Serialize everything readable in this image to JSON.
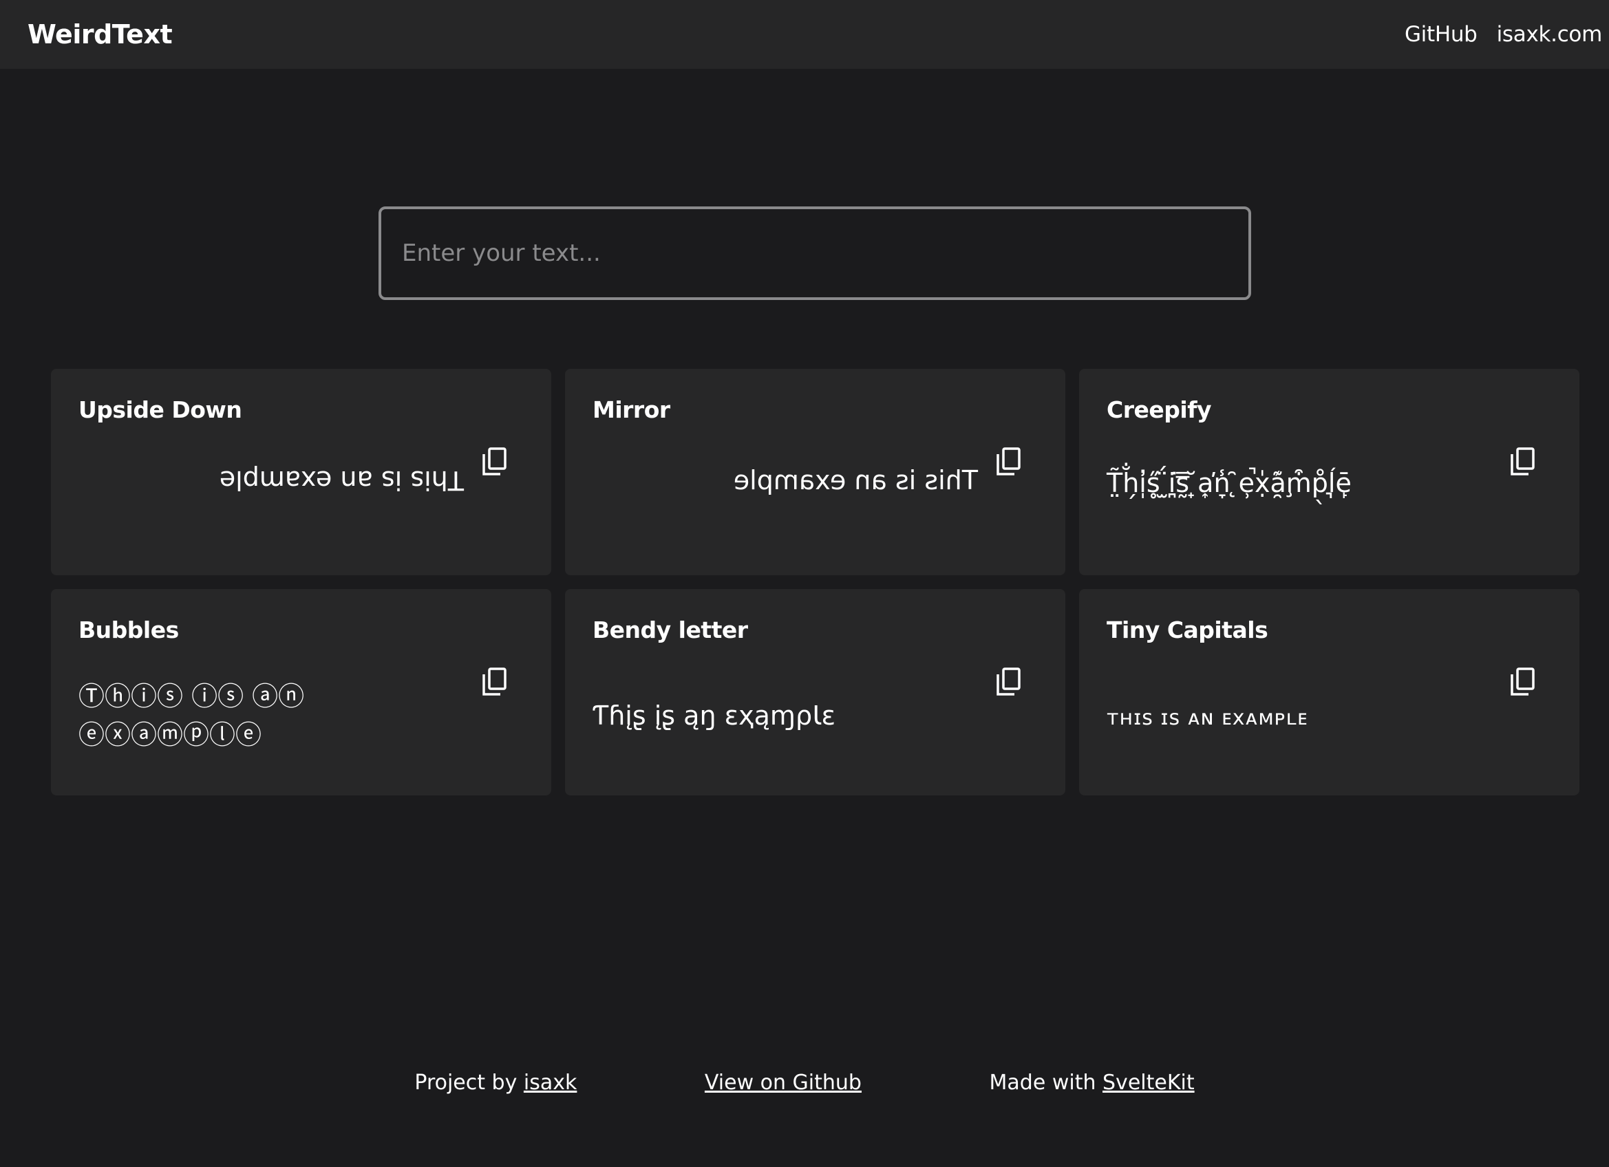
{
  "header": {
    "brand": "WeirdText",
    "links": [
      {
        "label": "GitHub"
      },
      {
        "label": "isaxk.com"
      }
    ]
  },
  "search": {
    "placeholder": "Enter your text...",
    "value": ""
  },
  "cards": [
    {
      "title": "Upside Down",
      "output": "This is an example"
    },
    {
      "title": "Mirror",
      "output": "This is an example"
    },
    {
      "title": "Creepify",
      "output": "T̤̃h̗̐i̩̓s̥̋ ̫̈́i̪͘s̰̿ ̟̆a͎̕n̞̾ ̨̑e̹̚x̣̍a̯͊m̧͒p̖̊ĺ͉ē̙"
    },
    {
      "title": "Bubbles",
      "output": "Ⓣⓗⓘⓢ ⓘⓢ ⓐⓝ ⓔⓧⓐⓜⓟⓛⓔ"
    },
    {
      "title": "Bendy letter",
      "output": "Ƭɦįʂ įʂ ąŋ ɛҳąɱρƖɛ"
    },
    {
      "title": "Tiny Capitals",
      "output": "ᴛʜɪꜱ ɪꜱ ᴀɴ ᴇxᴀᴍᴘʟᴇ"
    }
  ],
  "footer": {
    "project_prefix": "Project by ",
    "project_link": "isaxk",
    "github_link": "View on Github",
    "made_prefix": "Made with ",
    "made_link": "SvelteKit"
  },
  "icons": {
    "copy": "copy-icon"
  },
  "colors": {
    "background": "#1b1b1d",
    "navbar": "#262627",
    "card": "#272728",
    "input_border": "#8a8a8c",
    "text": "#ffffff"
  }
}
